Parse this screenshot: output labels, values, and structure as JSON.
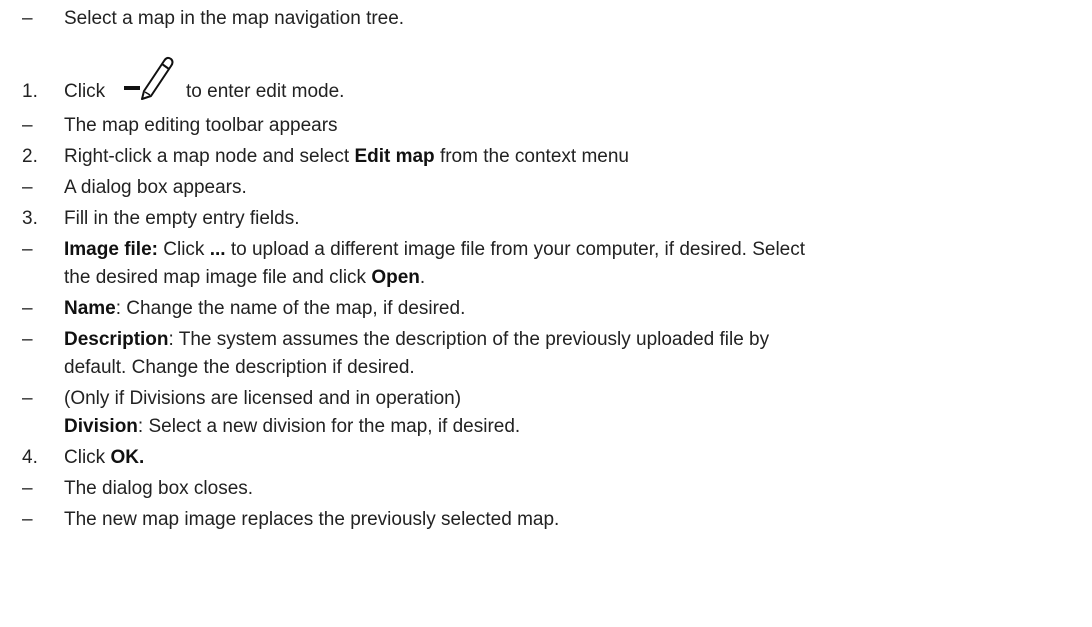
{
  "icons": {
    "edit_mode": "pencil-edit-icon"
  },
  "lines": [
    {
      "marker": "–",
      "text": "Select a map in the map navigation tree."
    },
    {
      "marker": "1.",
      "a": "Click",
      "b": "to enter edit mode."
    },
    {
      "marker": "–",
      "text": "The map editing toolbar appears"
    },
    {
      "marker": "2.",
      "a": "Right-click a map node and select ",
      "b": "Edit map",
      "c": " from the context menu"
    },
    {
      "marker": "–",
      "text": "A dialog box appears."
    },
    {
      "marker": "3.",
      "text": "Fill in the empty entry fields."
    },
    {
      "marker": "–",
      "a": "Image file:",
      "b": " Click ",
      "c": "...",
      "d": " to upload a different image file from your computer, if desired. Select"
    },
    {
      "a": "the desired map image file and click ",
      "b": "Open",
      "c": "."
    },
    {
      "marker": "–",
      "a": "Name",
      "b": ": Change the name of the map, if desired."
    },
    {
      "marker": "–",
      "a": "Description",
      "b": ": The system assumes the description of the previously uploaded file by"
    },
    {
      "text": "default. Change the description if desired."
    },
    {
      "marker": "–",
      "text": "(Only if Divisions are licensed and in operation)"
    },
    {
      "a": "Division",
      "b": ": Select a new division for the map, if desired."
    },
    {
      "marker": "4.",
      "a": "Click ",
      "b": "OK."
    },
    {
      "marker": "–",
      "text": "The dialog box closes."
    },
    {
      "marker": "–",
      "text": "The new map image replaces the previously selected map."
    }
  ]
}
